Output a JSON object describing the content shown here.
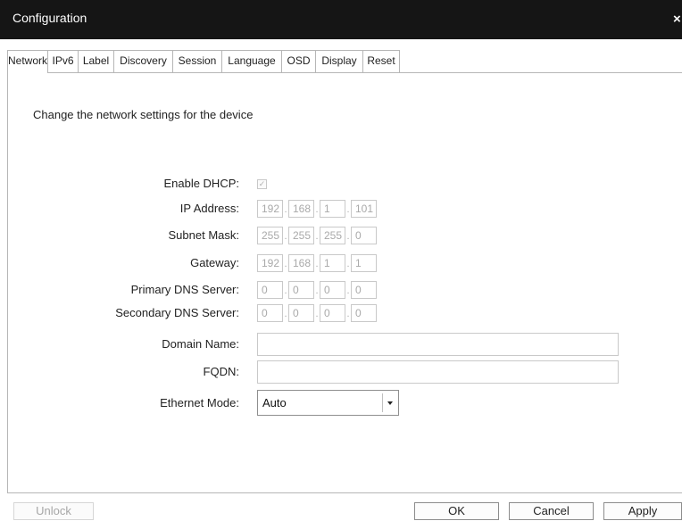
{
  "window": {
    "title": "Configuration",
    "close_glyph": "×"
  },
  "tabs": [
    {
      "label": "Network",
      "active": true
    },
    {
      "label": "IPv6",
      "active": false
    },
    {
      "label": "Label",
      "active": false
    },
    {
      "label": "Discovery",
      "active": false
    },
    {
      "label": "Session",
      "active": false
    },
    {
      "label": "Language",
      "active": false
    },
    {
      "label": "OSD",
      "active": false
    },
    {
      "label": "Display",
      "active": false
    },
    {
      "label": "Reset",
      "active": false
    }
  ],
  "panel": {
    "heading": "Change the network settings for the device"
  },
  "network": {
    "dhcp": {
      "label": "Enable DHCP:",
      "checked": true,
      "check_glyph": "✓"
    },
    "ip_address": {
      "label": "IP Address:",
      "octets": [
        "192",
        "168",
        "1",
        "101"
      ]
    },
    "subnet_mask": {
      "label": "Subnet Mask:",
      "octets": [
        "255",
        "255",
        "255",
        "0"
      ]
    },
    "gateway": {
      "label": "Gateway:",
      "octets": [
        "192",
        "168",
        "1",
        "1"
      ]
    },
    "primary_dns": {
      "label": "Primary DNS Server:",
      "octets": [
        "0",
        "0",
        "0",
        "0"
      ]
    },
    "secondary_dns": {
      "label": "Secondary DNS Server:",
      "octets": [
        "0",
        "0",
        "0",
        "0"
      ]
    },
    "domain_name": {
      "label": "Domain Name:",
      "value": ""
    },
    "fqdn": {
      "label": "FQDN:",
      "value": ""
    },
    "ethernet_mode": {
      "label": "Ethernet Mode:",
      "value": "Auto"
    }
  },
  "footer": {
    "unlock_label": "Unlock",
    "ok_label": "OK",
    "cancel_label": "Cancel",
    "apply_label": "Apply"
  }
}
